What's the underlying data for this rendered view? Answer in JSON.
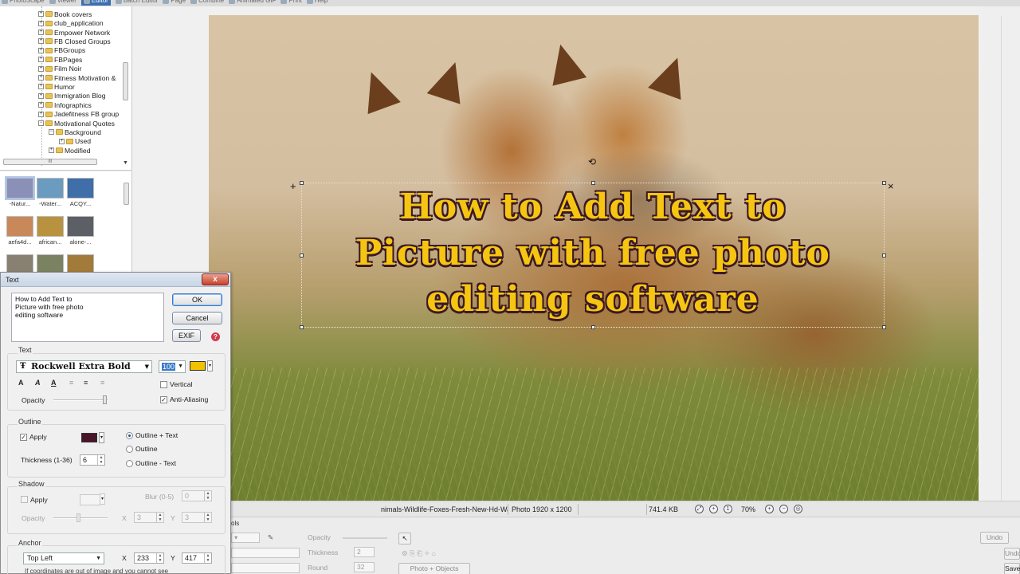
{
  "top_tabs": [
    "PhotoScape",
    "Viewer",
    "Editor",
    "Batch Editor",
    "Page",
    "Combine",
    "Animated GIF",
    "Print",
    "Help"
  ],
  "tree": {
    "items": [
      {
        "label": "Book covers",
        "level": 0
      },
      {
        "label": "club_application",
        "level": 0
      },
      {
        "label": "Empower Network",
        "level": 0
      },
      {
        "label": "FB Closed Groups",
        "level": 0
      },
      {
        "label": "FBGroups",
        "level": 0
      },
      {
        "label": "FBPages",
        "level": 0
      },
      {
        "label": "Film Noir",
        "level": 0
      },
      {
        "label": "Fitness Motivation &",
        "level": 0
      },
      {
        "label": "Humor",
        "level": 0
      },
      {
        "label": "Immigration Blog",
        "level": 0
      },
      {
        "label": "Infographics",
        "level": 0
      },
      {
        "label": "Jadefitness FB group",
        "level": 0
      },
      {
        "label": "Motivational Quotes",
        "level": 0
      },
      {
        "label": "Background",
        "level": 1
      },
      {
        "label": "Used",
        "level": 2
      },
      {
        "label": "Modified",
        "level": 1
      }
    ]
  },
  "thumbnails": [
    {
      "label": "-Natur...",
      "color": "#8a90b8"
    },
    {
      "label": "-Water...",
      "color": "#6b9cc0"
    },
    {
      "label": "ACQY...",
      "color": "#3f6ea8"
    },
    {
      "label": "aefa4d...",
      "color": "#c9885a"
    },
    {
      "label": "african...",
      "color": "#b8923e"
    },
    {
      "label": "alone-...",
      "color": "#5c5f66"
    },
    {
      "label": "",
      "color": "#888070"
    },
    {
      "label": "",
      "color": "#7a8262"
    },
    {
      "label": "",
      "color": "#a27a3a"
    }
  ],
  "canvas": {
    "overlay_text": "How to Add Text to\nPicture with free photo\nediting software",
    "text_color": "#f6c512",
    "outline_color": "#3a1a24"
  },
  "status": {
    "filename": "nimals-Wildlife-Foxes-Fresh-New-Hd-Wallp",
    "photo_size": "Photo 1920 x 1200",
    "file_size": "741.4 KB",
    "zoom": "70%"
  },
  "bottom": {
    "tab_fragment": "ols",
    "opacity_label": "Opacity",
    "thickness_label": "Thickness",
    "thickness_value": "2",
    "round_label": "Round",
    "round_value": "32",
    "photo_objects_label": "Photo + Objects",
    "undo_label": "Undo",
    "undo_all_label": "Undo",
    "save_label": "Save"
  },
  "dialog": {
    "title": "Text",
    "close_label": "x",
    "text_value": "How to Add Text to\nPicture with free photo\nediting software",
    "ok_label": "OK",
    "cancel_label": "Cancel",
    "exif_label": "EXIF",
    "text_section": "Text",
    "font": "Rockwell Extra Bold",
    "font_size": "100",
    "text_color": "#f2c200",
    "opacity_label": "Opacity",
    "vertical_label": "Vertical",
    "vertical_checked": false,
    "antialias_label": "Anti-Aliasing",
    "antialias_checked": true,
    "outline_section": "Outline",
    "outline_apply_label": "Apply",
    "outline_apply_checked": true,
    "outline_color": "#4a1528",
    "thickness_label": "Thickness (1-36)",
    "thickness_value": "6",
    "outline_modes": [
      "Outline + Text",
      "Outline",
      "Outline - Text"
    ],
    "outline_mode_selected": "Outline + Text",
    "shadow_section": "Shadow",
    "shadow_apply_label": "Apply",
    "shadow_apply_checked": false,
    "blur_label": "Blur (0-5)",
    "blur_value": "0",
    "shadow_opacity_label": "Opacity",
    "shadow_x_label": "X",
    "shadow_x_value": "3",
    "shadow_y_label": "Y",
    "shadow_y_value": "3",
    "anchor_section": "Anchor",
    "anchor_value": "Top Left",
    "anchor_x_label": "X",
    "anchor_x_value": "233",
    "anchor_y_label": "Y",
    "anchor_y_value": "417",
    "footnote": "If coordinates are out of image and you cannot see"
  }
}
